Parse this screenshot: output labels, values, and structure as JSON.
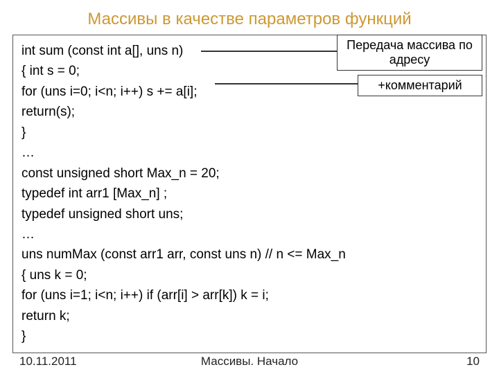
{
  "title": "Массивы в качестве параметров функций",
  "callout1_line1": "Передача массива по",
  "callout1_line2": "адресу",
  "callout2": "+комментарий",
  "code": {
    "l1": "int sum (const int a[], uns n)",
    "l2": "{   int s = 0;",
    "l3": "    for (uns i=0; i<n; i++) s += a[i];",
    "l4": "    return(s);",
    "l5": "}",
    "l6": "…",
    "l7": "const unsigned short Max_n = 20;",
    "l8": "typedef int arr1 [Max_n] ;",
    "l9": "typedef unsigned short uns;",
    "l10": "…",
    "l11a": "uns numMax (const arr1 arr, const uns n) ",
    "l11b": "// n <= Max_n",
    "l12": "{   uns k = 0;",
    "l13": "    for (uns i=1; i<n; i++) if (arr[i] > arr[k])  k = i;",
    "l14": "    return k;",
    "l15": "}"
  },
  "footer": {
    "date": "10.11.2011",
    "center": "Массивы. Начало",
    "page": "10"
  }
}
